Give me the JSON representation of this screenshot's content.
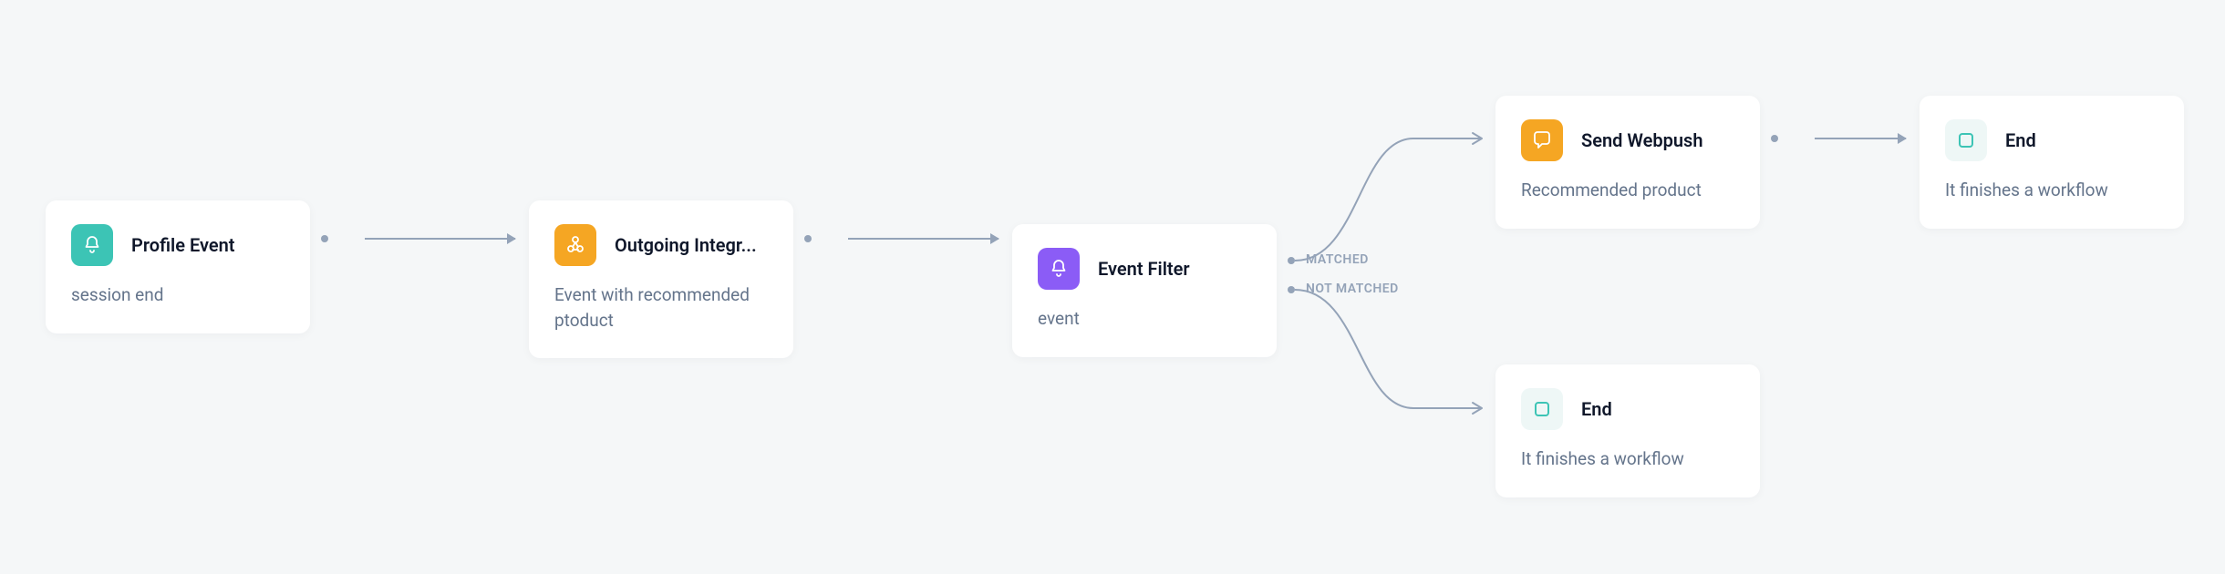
{
  "nodes": {
    "profile_event": {
      "title": "Profile Event",
      "subtitle": "session end"
    },
    "outgoing_integr": {
      "title": "Outgoing Integr...",
      "subtitle": "Event with recommended ptoduct"
    },
    "event_filter": {
      "title": "Event Filter",
      "subtitle": "event"
    },
    "send_webpush": {
      "title": "Send Webpush",
      "subtitle": "Recommended product"
    },
    "end_top": {
      "title": "End",
      "subtitle": "It finishes a workflow"
    },
    "end_bottom": {
      "title": "End",
      "subtitle": "It finishes a workflow"
    }
  },
  "branch_labels": {
    "matched": "MATCHED",
    "not_matched": "NOT MATCHED"
  },
  "icons": {
    "bell": "bell-icon",
    "webhook": "webhook-icon",
    "chat": "chat-icon",
    "square": "square-icon"
  }
}
